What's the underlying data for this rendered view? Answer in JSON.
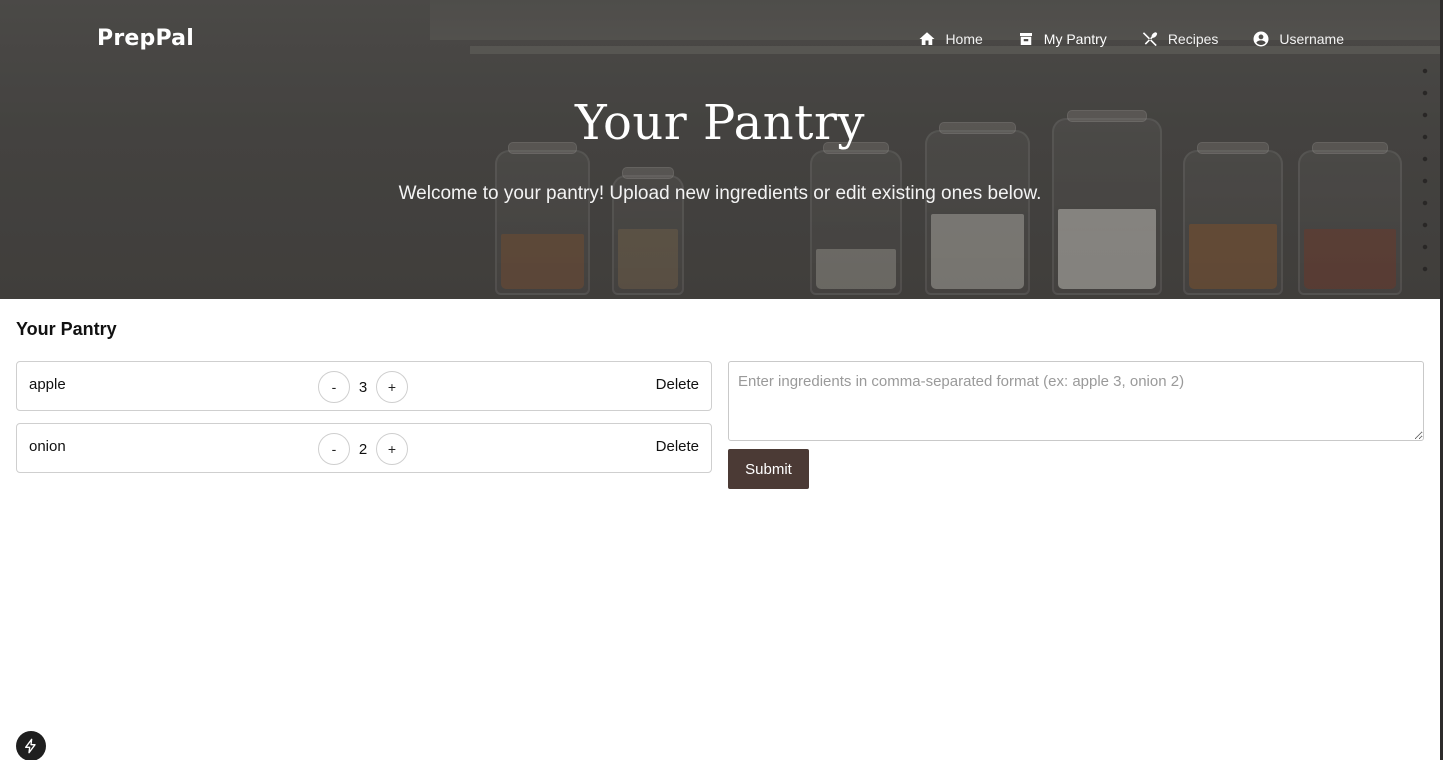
{
  "brand": {
    "name": "PrepPal"
  },
  "nav": {
    "items": [
      {
        "label": "Home",
        "icon": "home-icon"
      },
      {
        "label": "My Pantry",
        "icon": "pantry-icon",
        "active": true
      },
      {
        "label": "Recipes",
        "icon": "utensils-icon"
      },
      {
        "label": "Username",
        "icon": "user-icon"
      }
    ]
  },
  "hero": {
    "title": "Your Pantry",
    "subtitle": "Welcome to your pantry! Upload new ingredients or edit existing ones below."
  },
  "pantry": {
    "section_title": "Your Pantry",
    "decrement_label": "-",
    "increment_label": "+",
    "delete_label": "Delete",
    "items": [
      {
        "name": "apple",
        "quantity": "3"
      },
      {
        "name": "onion",
        "quantity": "2"
      }
    ]
  },
  "ingredient_form": {
    "placeholder": "Enter ingredients in comma-separated format (ex: apple 3, onion 2)",
    "value": "",
    "submit_label": "Submit"
  },
  "colors": {
    "submit_bg": "#4b3a35",
    "hero_overlay": "#4f4d4b"
  }
}
